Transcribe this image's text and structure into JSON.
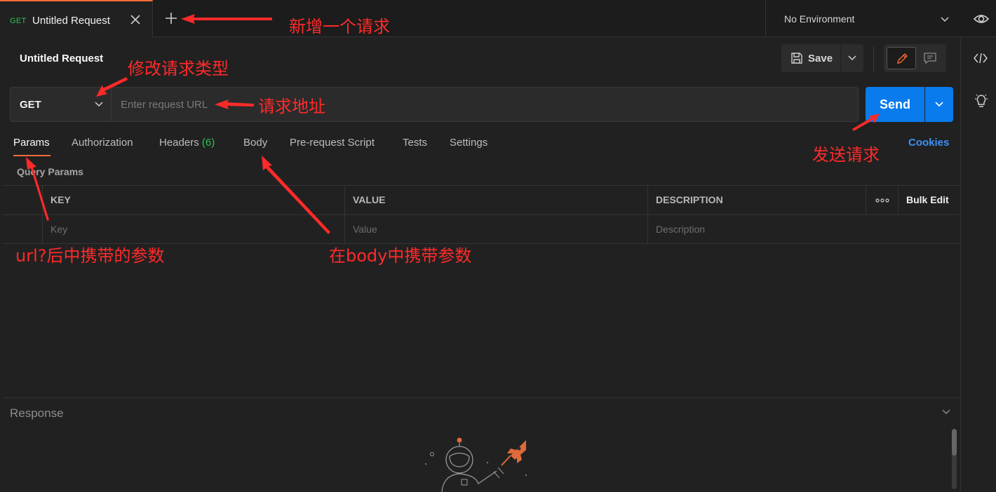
{
  "tab": {
    "method": "GET",
    "title": "Untitled Request"
  },
  "environment": {
    "selected": "No Environment"
  },
  "request": {
    "title": "Untitled Request",
    "save_label": "Save",
    "method": "GET",
    "url_placeholder": "Enter request URL",
    "send_label": "Send"
  },
  "subtabs": {
    "params": "Params",
    "authorization": "Authorization",
    "headers": "Headers",
    "headers_count": "(6)",
    "body": "Body",
    "prerequest": "Pre-request Script",
    "tests": "Tests",
    "settings": "Settings",
    "cookies": "Cookies"
  },
  "params": {
    "section_title": "Query Params",
    "columns": {
      "key": "KEY",
      "value": "VALUE",
      "description": "DESCRIPTION",
      "bulk_edit": "Bulk Edit"
    },
    "placeholders": {
      "key": "Key",
      "value": "Value",
      "description": "Description"
    }
  },
  "response": {
    "title": "Response"
  },
  "annotations": {
    "new_request": "新增一个请求",
    "change_method": "修改请求类型",
    "request_url": "请求地址",
    "send_request": "发送请求",
    "url_params": "url?后中携带的参数",
    "body_params": "在body中携带参数"
  },
  "colors": {
    "accent": "#ff6c37",
    "send_blue": "#097bed",
    "get_green": "#2fc15c",
    "annotation_red": "#ff2a2a",
    "link_blue": "#3d92f5"
  }
}
